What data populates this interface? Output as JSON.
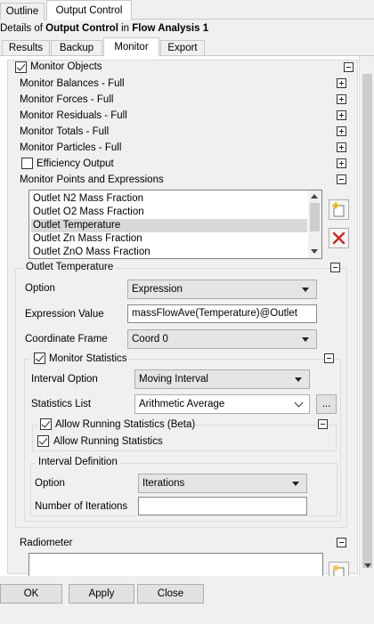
{
  "top_tabs": [
    "Outline",
    "Output Control"
  ],
  "details": {
    "prefix": "Details of ",
    "object": "Output Control",
    "mid": " in ",
    "parent": "Flow Analysis 1"
  },
  "sub_tabs": [
    "Results",
    "Backup",
    "Monitor",
    "Export"
  ],
  "monitor_objects": {
    "label": "Monitor Objects",
    "checked": true
  },
  "sections": [
    "Monitor Balances - Full",
    "Monitor Forces - Full",
    "Monitor Residuals - Full",
    "Monitor Totals - Full",
    "Monitor Particles - Full"
  ],
  "efficiency_output": {
    "label": "Efficiency Output",
    "checked": false
  },
  "monitor_points": {
    "label": "Monitor Points and Expressions",
    "items": [
      "Outlet N2 Mass Fraction",
      "Outlet O2 Mass Fraction",
      "Outlet Temperature",
      "Outlet Zn Mass Fraction",
      "Outlet ZnO Mass Fraction"
    ],
    "selected_index": 2
  },
  "outlet_temperature": {
    "title": "Outlet Temperature",
    "option_label": "Option",
    "option_value": "Expression",
    "expression_label": "Expression Value",
    "expression_value": "massFlowAve(Temperature)@Outlet",
    "frame_label": "Coordinate Frame",
    "frame_value": "Coord 0"
  },
  "monitor_statistics": {
    "label": "Monitor Statistics",
    "checked": true,
    "interval_option_label": "Interval Option",
    "interval_option_value": "Moving Interval",
    "statistics_list_label": "Statistics List",
    "statistics_list_value": "Arithmetic Average",
    "ellipsis": "...",
    "running_beta_label": "Allow Running Statistics (Beta)",
    "running_label": "Allow Running Statistics"
  },
  "interval_definition": {
    "title": "Interval Definition",
    "option_label": "Option",
    "option_value": "Iterations",
    "iterations_label": "Number of Iterations",
    "iterations_value": ""
  },
  "radiometer": {
    "label": "Radiometer"
  },
  "buttons": {
    "ok": "OK",
    "apply": "Apply",
    "close": "Close"
  }
}
